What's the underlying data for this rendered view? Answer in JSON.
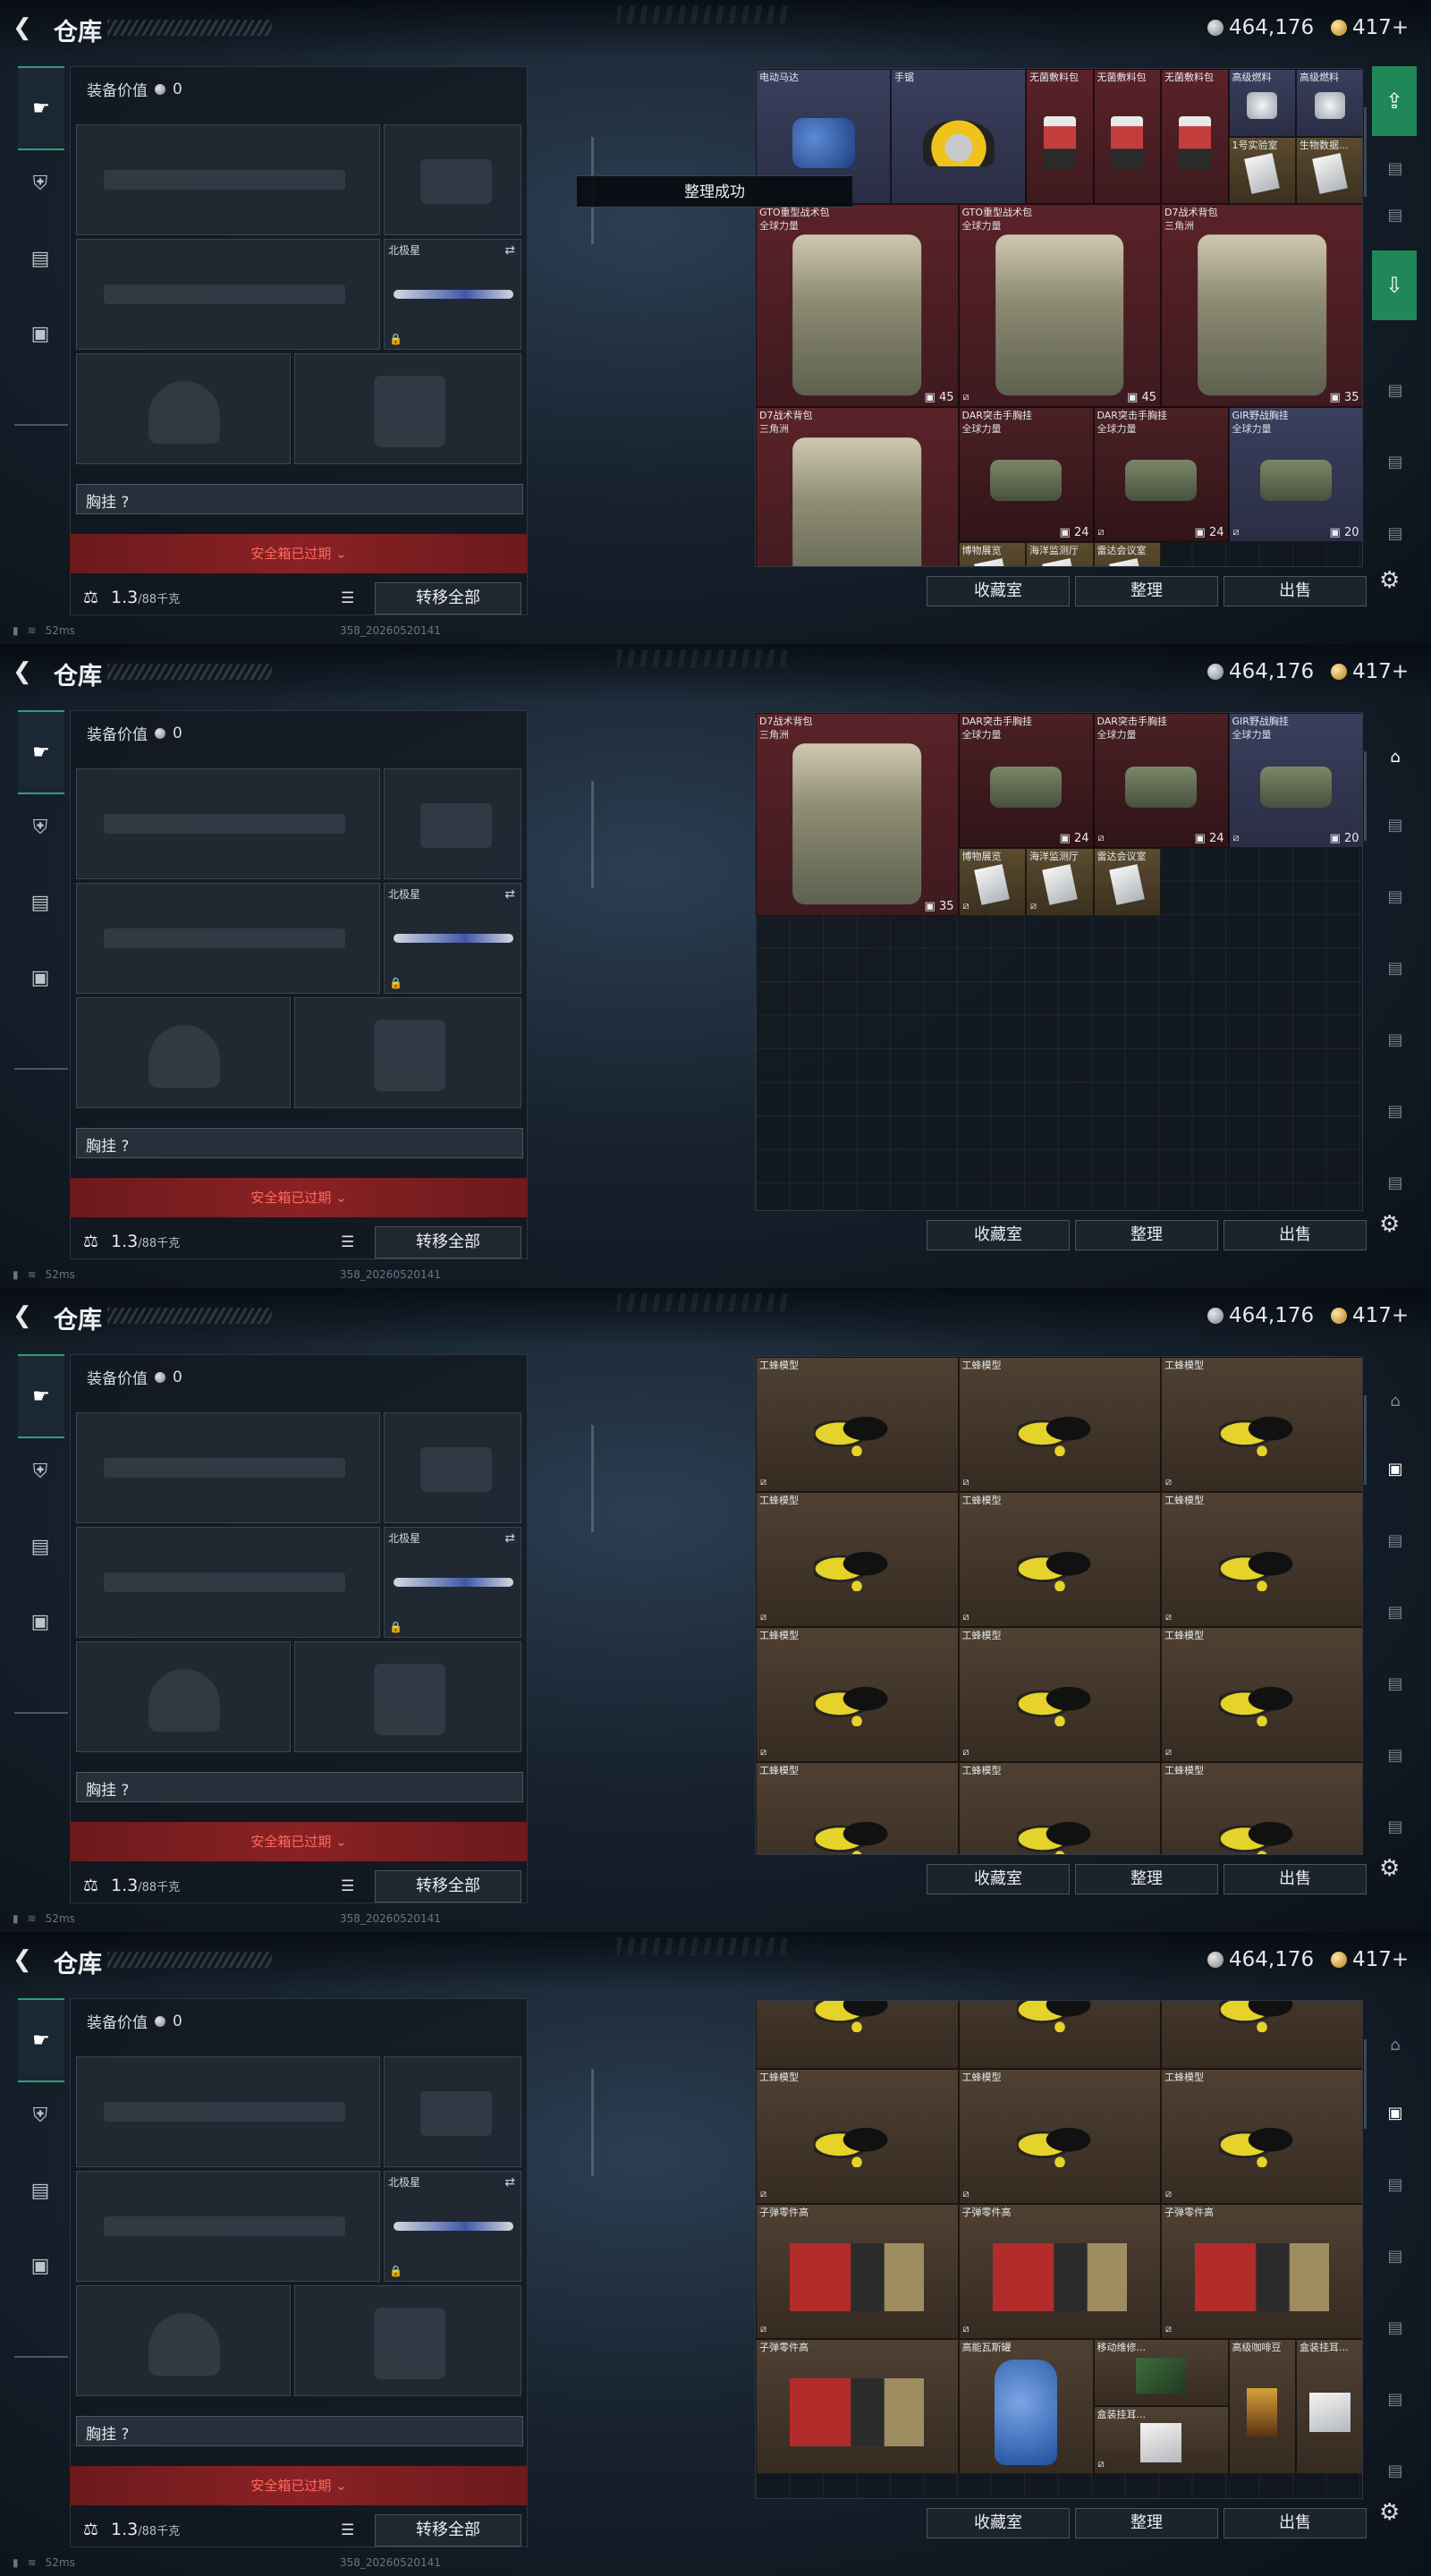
{
  "header": {
    "title": "仓库",
    "silver": "464,176",
    "gold": "417+"
  },
  "loadout": {
    "equip_label": "装备价值",
    "equip_value": "0",
    "northstar": "北极星",
    "chest": "胸挂 ?",
    "safebox": "安全箱已过期",
    "weight_value": "1.3",
    "weight_max": "/88千克",
    "transfer": "转移全部"
  },
  "status": {
    "ping": "52ms",
    "build": "358_20260520141"
  },
  "actions": {
    "fav": "收藏室",
    "sort": "整理",
    "sell": "出售"
  },
  "toast": "整理成功",
  "icons": {
    "back": "back-arrow-icon",
    "gun": "gun-icon",
    "helmet": "helmet-icon",
    "vest": "vest-icon",
    "bag": "briefcase-icon",
    "coin_silver": "silver-coin-icon",
    "coin_gold": "gold-coin-icon",
    "settings": "gear-icon"
  },
  "screens": [
    {
      "items": [
        {
          "name": "电动马达",
          "sub": "",
          "col": "blue",
          "pic": "motor",
          "x": 0,
          "y": 0,
          "w": 2,
          "h": 2
        },
        {
          "name": "手锯",
          "sub": "",
          "col": "blue",
          "pic": "saw",
          "x": 2,
          "y": 0,
          "w": 2,
          "h": 2
        },
        {
          "name": "无菌敷料包",
          "sub": "",
          "col": "red",
          "pic": "pack",
          "x": 4,
          "y": 0,
          "w": 1,
          "h": 2
        },
        {
          "name": "无菌敷料包",
          "sub": "",
          "col": "red",
          "pic": "pack",
          "x": 5,
          "y": 0,
          "w": 1,
          "h": 2
        },
        {
          "name": "无菌敷料包",
          "sub": "",
          "col": "red",
          "pic": "pack",
          "x": 6,
          "y": 0,
          "w": 1,
          "h": 2
        },
        {
          "name": "高级燃料",
          "sub": "",
          "col": "blue",
          "pic": "fuel",
          "x": 7,
          "y": 0,
          "w": 1,
          "h": 1
        },
        {
          "name": "高级燃料",
          "sub": "",
          "col": "blue",
          "pic": "fuel",
          "x": 8,
          "y": 0,
          "w": 1,
          "h": 1
        },
        {
          "name": "1号实验室",
          "sub": "",
          "col": "gold",
          "pic": "doc",
          "x": 7,
          "y": 1,
          "w": 1,
          "h": 1
        },
        {
          "name": "生物数据...",
          "sub": "",
          "col": "gold",
          "pic": "doc",
          "x": 8,
          "y": 1,
          "w": 1,
          "h": 1
        },
        {
          "name": "GTO重型战术包",
          "sub": "全球力量",
          "col": "red",
          "pic": "bag",
          "x": 0,
          "y": 2,
          "w": 3,
          "h": 3,
          "count": "45",
          "flag": ""
        },
        {
          "name": "GTO重型战术包",
          "sub": "全球力量",
          "col": "red",
          "pic": "bag",
          "x": 3,
          "y": 2,
          "w": 3,
          "h": 3,
          "count": "45",
          "flag": "⧄"
        },
        {
          "name": "D7战术背包",
          "sub": "三角洲",
          "col": "red",
          "pic": "bag",
          "x": 6,
          "y": 2,
          "w": 3,
          "h": 3,
          "count": "35",
          "flag": ""
        },
        {
          "name": "D7战术背包",
          "sub": "三角洲",
          "col": "red",
          "pic": "bag",
          "x": 0,
          "y": 5,
          "w": 3,
          "h": 3,
          "count": "",
          "flag": ""
        },
        {
          "name": "DAR突击手胸挂",
          "sub": "全球力量",
          "col": "dkred",
          "pic": "rig",
          "x": 3,
          "y": 5,
          "w": 2,
          "h": 2,
          "count": "24",
          "flag": ""
        },
        {
          "name": "DAR突击手胸挂",
          "sub": "全球力量",
          "col": "dkred",
          "pic": "rig",
          "x": 5,
          "y": 5,
          "w": 2,
          "h": 2,
          "count": "24",
          "flag": "⧄"
        },
        {
          "name": "GIR野战胸挂",
          "sub": "全球力量",
          "col": "blue",
          "pic": "rig",
          "x": 7,
          "y": 5,
          "w": 2,
          "h": 2,
          "count": "20",
          "flag": "⧄"
        },
        {
          "name": "博物展览",
          "sub": "",
          "col": "gold",
          "pic": "doc",
          "x": 3,
          "y": 7,
          "w": 1,
          "h": 1
        },
        {
          "name": "海洋监测厅",
          "sub": "",
          "col": "gold",
          "pic": "doc",
          "x": 4,
          "y": 7,
          "w": 1,
          "h": 1
        },
        {
          "name": "雷达会议室",
          "sub": "",
          "col": "gold",
          "pic": "doc",
          "x": 5,
          "y": 7,
          "w": 1,
          "h": 1
        }
      ]
    },
    {
      "items": [
        {
          "name": "D7战术背包",
          "sub": "三角洲",
          "col": "red",
          "pic": "bag",
          "x": 0,
          "y": 0,
          "w": 3,
          "h": 3,
          "count": "35",
          "flag": ""
        },
        {
          "name": "DAR突击手胸挂",
          "sub": "全球力量",
          "col": "dkred",
          "pic": "rig",
          "x": 3,
          "y": 0,
          "w": 2,
          "h": 2,
          "count": "24",
          "flag": ""
        },
        {
          "name": "DAR突击手胸挂",
          "sub": "全球力量",
          "col": "dkred",
          "pic": "rig",
          "x": 5,
          "y": 0,
          "w": 2,
          "h": 2,
          "count": "24",
          "flag": "⧄"
        },
        {
          "name": "GIR野战胸挂",
          "sub": "全球力量",
          "col": "blue",
          "pic": "rig",
          "x": 7,
          "y": 0,
          "w": 2,
          "h": 2,
          "count": "20",
          "flag": "⧄"
        },
        {
          "name": "博物展览",
          "sub": "",
          "col": "gold",
          "pic": "doc",
          "x": 3,
          "y": 2,
          "w": 1,
          "h": 1,
          "flag": "⧄"
        },
        {
          "name": "海洋监测厅",
          "sub": "",
          "col": "gold",
          "pic": "doc",
          "x": 4,
          "y": 2,
          "w": 1,
          "h": 1,
          "flag": "⧄"
        },
        {
          "name": "雷达会议室",
          "sub": "",
          "col": "gold",
          "pic": "doc",
          "x": 5,
          "y": 2,
          "w": 1,
          "h": 1
        }
      ]
    },
    {
      "items": [
        {
          "name": "工蜂模型",
          "col": "brown",
          "pic": "bee",
          "x": 0,
          "y": 0,
          "w": 3,
          "h": 2,
          "flag": "⧄"
        },
        {
          "name": "工蜂模型",
          "col": "brown",
          "pic": "bee",
          "x": 3,
          "y": 0,
          "w": 3,
          "h": 2,
          "flag": "⧄"
        },
        {
          "name": "工蜂模型",
          "col": "brown",
          "pic": "bee",
          "x": 6,
          "y": 0,
          "w": 3,
          "h": 2,
          "flag": "⧄"
        },
        {
          "name": "工蜂模型",
          "col": "brown",
          "pic": "bee",
          "x": 0,
          "y": 2,
          "w": 3,
          "h": 2,
          "flag": "⧄"
        },
        {
          "name": "工蜂模型",
          "col": "brown",
          "pic": "bee",
          "x": 3,
          "y": 2,
          "w": 3,
          "h": 2,
          "flag": "⧄"
        },
        {
          "name": "工蜂模型",
          "col": "brown",
          "pic": "bee",
          "x": 6,
          "y": 2,
          "w": 3,
          "h": 2,
          "flag": "⧄"
        },
        {
          "name": "工蜂模型",
          "col": "brown",
          "pic": "bee",
          "x": 0,
          "y": 4,
          "w": 3,
          "h": 2,
          "flag": "⧄"
        },
        {
          "name": "工蜂模型",
          "col": "brown",
          "pic": "bee",
          "x": 3,
          "y": 4,
          "w": 3,
          "h": 2,
          "flag": "⧄"
        },
        {
          "name": "工蜂模型",
          "col": "brown",
          "pic": "bee",
          "x": 6,
          "y": 4,
          "w": 3,
          "h": 2,
          "flag": "⧄"
        },
        {
          "name": "工蜂模型",
          "col": "brown",
          "pic": "bee",
          "x": 0,
          "y": 6,
          "w": 3,
          "h": 2
        },
        {
          "name": "工蜂模型",
          "col": "brown",
          "pic": "bee",
          "x": 3,
          "y": 6,
          "w": 3,
          "h": 2
        },
        {
          "name": "工蜂模型",
          "col": "brown",
          "pic": "bee",
          "x": 6,
          "y": 6,
          "w": 3,
          "h": 2
        }
      ]
    },
    {
      "items": [
        {
          "name": "",
          "col": "brown",
          "pic": "bee",
          "x": 0,
          "y": -1,
          "w": 3,
          "h": 2
        },
        {
          "name": "",
          "col": "brown",
          "pic": "bee",
          "x": 3,
          "y": -1,
          "w": 3,
          "h": 2
        },
        {
          "name": "",
          "col": "brown",
          "pic": "bee",
          "x": 6,
          "y": -1,
          "w": 3,
          "h": 2
        },
        {
          "name": "工蜂模型",
          "col": "brown",
          "pic": "bee",
          "x": 0,
          "y": 1,
          "w": 3,
          "h": 2,
          "flag": "⧄"
        },
        {
          "name": "工蜂模型",
          "col": "brown",
          "pic": "bee",
          "x": 3,
          "y": 1,
          "w": 3,
          "h": 2,
          "flag": "⧄"
        },
        {
          "name": "工蜂模型",
          "col": "brown",
          "pic": "bee",
          "x": 6,
          "y": 1,
          "w": 3,
          "h": 2,
          "flag": "⧄"
        },
        {
          "name": "子弹零件高",
          "col": "brown",
          "pic": "ammo",
          "x": 0,
          "y": 3,
          "w": 3,
          "h": 2,
          "flag": "⧄"
        },
        {
          "name": "子弹零件高",
          "col": "brown",
          "pic": "ammo",
          "x": 3,
          "y": 3,
          "w": 3,
          "h": 2,
          "flag": "⧄"
        },
        {
          "name": "子弹零件高",
          "col": "brown",
          "pic": "ammo",
          "x": 6,
          "y": 3,
          "w": 3,
          "h": 2,
          "flag": "⧄"
        },
        {
          "name": "子弹零件高",
          "col": "brown",
          "pic": "ammo",
          "x": 0,
          "y": 5,
          "w": 3,
          "h": 2
        },
        {
          "name": "高能瓦斯罐",
          "col": "brown",
          "pic": "tank",
          "x": 3,
          "y": 5,
          "w": 2,
          "h": 2
        },
        {
          "name": "移动维修...",
          "col": "brown",
          "pic": "pcb",
          "x": 5,
          "y": 5,
          "w": 2,
          "h": 1
        },
        {
          "name": "高级咖啡豆",
          "col": "brown",
          "pic": "coffee",
          "x": 7,
          "y": 5,
          "w": 1,
          "h": 2
        },
        {
          "name": "盒装挂耳...",
          "col": "brown",
          "pic": "box",
          "x": 8,
          "y": 5,
          "w": 1,
          "h": 2
        },
        {
          "name": "盒装挂耳...",
          "col": "brown",
          "pic": "box",
          "x": 5,
          "y": 6,
          "w": 2,
          "h": 1,
          "flag": "⧄"
        }
      ]
    }
  ]
}
